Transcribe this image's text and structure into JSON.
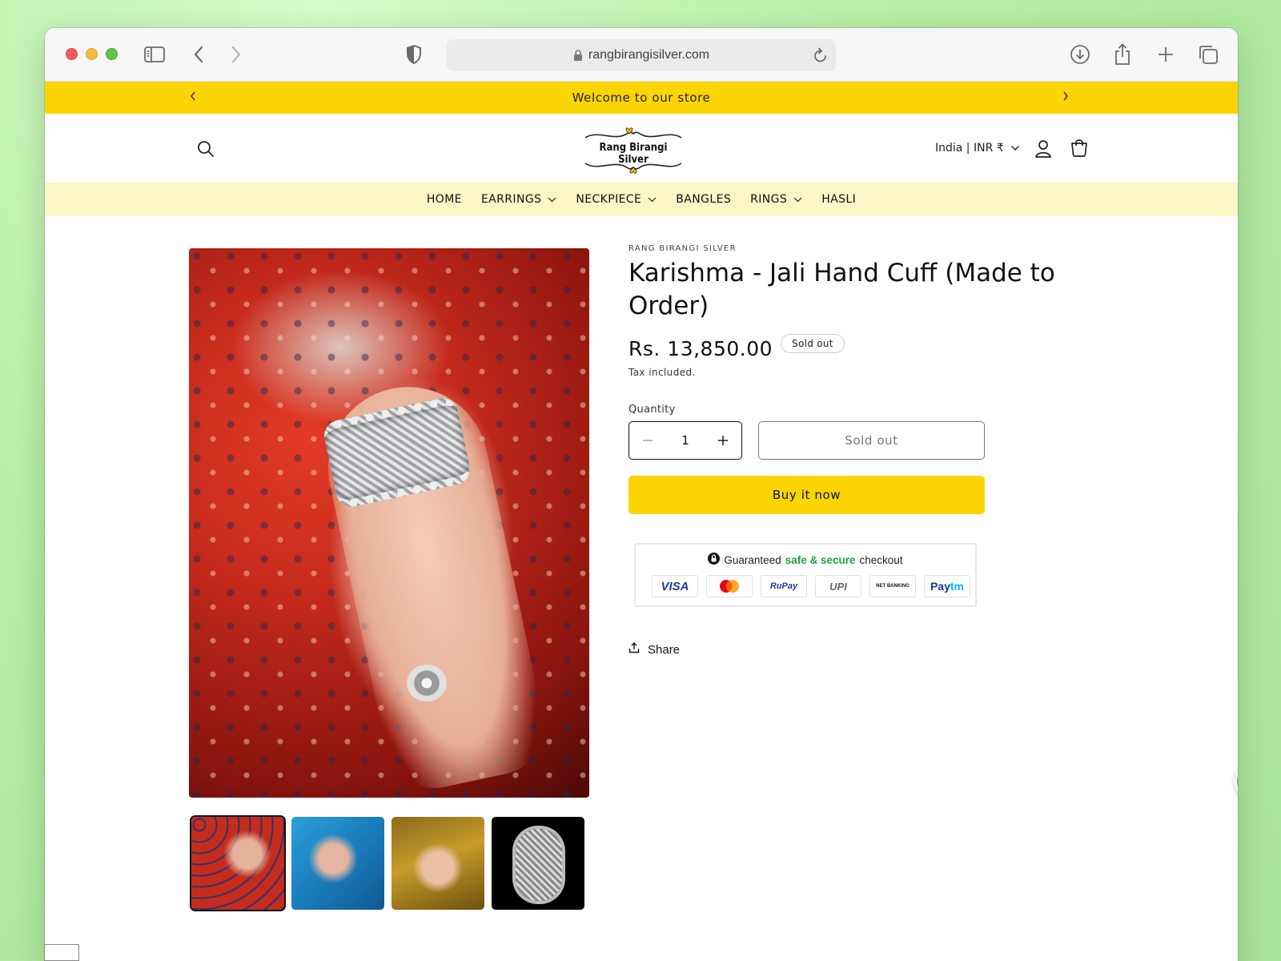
{
  "browser": {
    "url": "rangbirangisilver.com"
  },
  "announcement": {
    "text": "Welcome to our store"
  },
  "header": {
    "logo_text": "Rang Birangi Silver",
    "country_selector": "India | INR ₹"
  },
  "nav": {
    "items": [
      {
        "label": "HOME",
        "dropdown": false
      },
      {
        "label": "EARRINGS",
        "dropdown": true
      },
      {
        "label": "NECKPIECE",
        "dropdown": true
      },
      {
        "label": "BANGLES",
        "dropdown": false
      },
      {
        "label": "RINGS",
        "dropdown": true
      },
      {
        "label": "HASLI",
        "dropdown": false
      }
    ]
  },
  "product": {
    "vendor": "RANG BIRANGI SILVER",
    "title": "Karishma - Jali Hand Cuff (Made to Order)",
    "price": "Rs. 13,850.00",
    "badge": "Sold out",
    "tax_note": "Tax included.",
    "quantity_label": "Quantity",
    "quantity_value": "1",
    "sold_out_button": "Sold out",
    "buy_now_button": "Buy it now",
    "share_label": "Share"
  },
  "secure_checkout": {
    "prefix": "Guaranteed",
    "highlight": "safe & secure",
    "suffix": "checkout",
    "payment_methods": [
      "VISA",
      "Mastercard",
      "RuPay",
      "UPI",
      "NET BANKING",
      "Paytm"
    ]
  },
  "colors": {
    "accent_yellow": "#fad503",
    "nav_background": "#fcf6c6",
    "secure_green": "#1ea33d"
  }
}
